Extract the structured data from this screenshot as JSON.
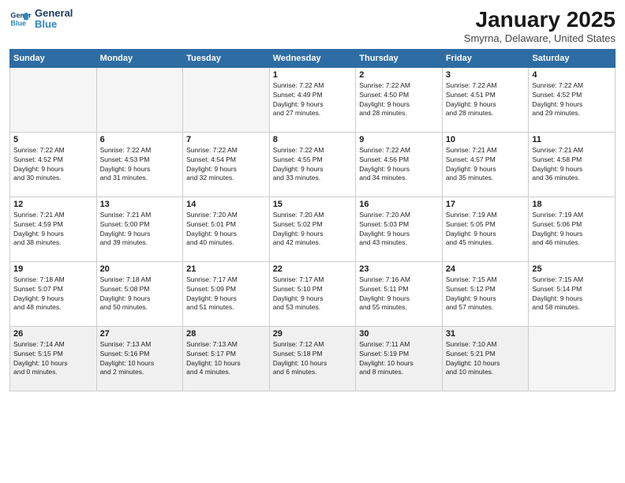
{
  "logo": {
    "line1": "General",
    "line2": "Blue"
  },
  "title": "January 2025",
  "subtitle": "Smyrna, Delaware, United States",
  "weekdays": [
    "Sunday",
    "Monday",
    "Tuesday",
    "Wednesday",
    "Thursday",
    "Friday",
    "Saturday"
  ],
  "weeks": [
    [
      {
        "day": "",
        "info": ""
      },
      {
        "day": "",
        "info": ""
      },
      {
        "day": "",
        "info": ""
      },
      {
        "day": "1",
        "info": "Sunrise: 7:22 AM\nSunset: 4:49 PM\nDaylight: 9 hours\nand 27 minutes."
      },
      {
        "day": "2",
        "info": "Sunrise: 7:22 AM\nSunset: 4:50 PM\nDaylight: 9 hours\nand 28 minutes."
      },
      {
        "day": "3",
        "info": "Sunrise: 7:22 AM\nSunset: 4:51 PM\nDaylight: 9 hours\nand 28 minutes."
      },
      {
        "day": "4",
        "info": "Sunrise: 7:22 AM\nSunset: 4:52 PM\nDaylight: 9 hours\nand 29 minutes."
      }
    ],
    [
      {
        "day": "5",
        "info": "Sunrise: 7:22 AM\nSunset: 4:52 PM\nDaylight: 9 hours\nand 30 minutes."
      },
      {
        "day": "6",
        "info": "Sunrise: 7:22 AM\nSunset: 4:53 PM\nDaylight: 9 hours\nand 31 minutes."
      },
      {
        "day": "7",
        "info": "Sunrise: 7:22 AM\nSunset: 4:54 PM\nDaylight: 9 hours\nand 32 minutes."
      },
      {
        "day": "8",
        "info": "Sunrise: 7:22 AM\nSunset: 4:55 PM\nDaylight: 9 hours\nand 33 minutes."
      },
      {
        "day": "9",
        "info": "Sunrise: 7:22 AM\nSunset: 4:56 PM\nDaylight: 9 hours\nand 34 minutes."
      },
      {
        "day": "10",
        "info": "Sunrise: 7:21 AM\nSunset: 4:57 PM\nDaylight: 9 hours\nand 35 minutes."
      },
      {
        "day": "11",
        "info": "Sunrise: 7:21 AM\nSunset: 4:58 PM\nDaylight: 9 hours\nand 36 minutes."
      }
    ],
    [
      {
        "day": "12",
        "info": "Sunrise: 7:21 AM\nSunset: 4:59 PM\nDaylight: 9 hours\nand 38 minutes."
      },
      {
        "day": "13",
        "info": "Sunrise: 7:21 AM\nSunset: 5:00 PM\nDaylight: 9 hours\nand 39 minutes."
      },
      {
        "day": "14",
        "info": "Sunrise: 7:20 AM\nSunset: 5:01 PM\nDaylight: 9 hours\nand 40 minutes."
      },
      {
        "day": "15",
        "info": "Sunrise: 7:20 AM\nSunset: 5:02 PM\nDaylight: 9 hours\nand 42 minutes."
      },
      {
        "day": "16",
        "info": "Sunrise: 7:20 AM\nSunset: 5:03 PM\nDaylight: 9 hours\nand 43 minutes."
      },
      {
        "day": "17",
        "info": "Sunrise: 7:19 AM\nSunset: 5:05 PM\nDaylight: 9 hours\nand 45 minutes."
      },
      {
        "day": "18",
        "info": "Sunrise: 7:19 AM\nSunset: 5:06 PM\nDaylight: 9 hours\nand 46 minutes."
      }
    ],
    [
      {
        "day": "19",
        "info": "Sunrise: 7:18 AM\nSunset: 5:07 PM\nDaylight: 9 hours\nand 48 minutes."
      },
      {
        "day": "20",
        "info": "Sunrise: 7:18 AM\nSunset: 5:08 PM\nDaylight: 9 hours\nand 50 minutes."
      },
      {
        "day": "21",
        "info": "Sunrise: 7:17 AM\nSunset: 5:09 PM\nDaylight: 9 hours\nand 51 minutes."
      },
      {
        "day": "22",
        "info": "Sunrise: 7:17 AM\nSunset: 5:10 PM\nDaylight: 9 hours\nand 53 minutes."
      },
      {
        "day": "23",
        "info": "Sunrise: 7:16 AM\nSunset: 5:11 PM\nDaylight: 9 hours\nand 55 minutes."
      },
      {
        "day": "24",
        "info": "Sunrise: 7:15 AM\nSunset: 5:12 PM\nDaylight: 9 hours\nand 57 minutes."
      },
      {
        "day": "25",
        "info": "Sunrise: 7:15 AM\nSunset: 5:14 PM\nDaylight: 9 hours\nand 58 minutes."
      }
    ],
    [
      {
        "day": "26",
        "info": "Sunrise: 7:14 AM\nSunset: 5:15 PM\nDaylight: 10 hours\nand 0 minutes."
      },
      {
        "day": "27",
        "info": "Sunrise: 7:13 AM\nSunset: 5:16 PM\nDaylight: 10 hours\nand 2 minutes."
      },
      {
        "day": "28",
        "info": "Sunrise: 7:13 AM\nSunset: 5:17 PM\nDaylight: 10 hours\nand 4 minutes."
      },
      {
        "day": "29",
        "info": "Sunrise: 7:12 AM\nSunset: 5:18 PM\nDaylight: 10 hours\nand 6 minutes."
      },
      {
        "day": "30",
        "info": "Sunrise: 7:11 AM\nSunset: 5:19 PM\nDaylight: 10 hours\nand 8 minutes."
      },
      {
        "day": "31",
        "info": "Sunrise: 7:10 AM\nSunset: 5:21 PM\nDaylight: 10 hours\nand 10 minutes."
      },
      {
        "day": "",
        "info": ""
      }
    ]
  ]
}
